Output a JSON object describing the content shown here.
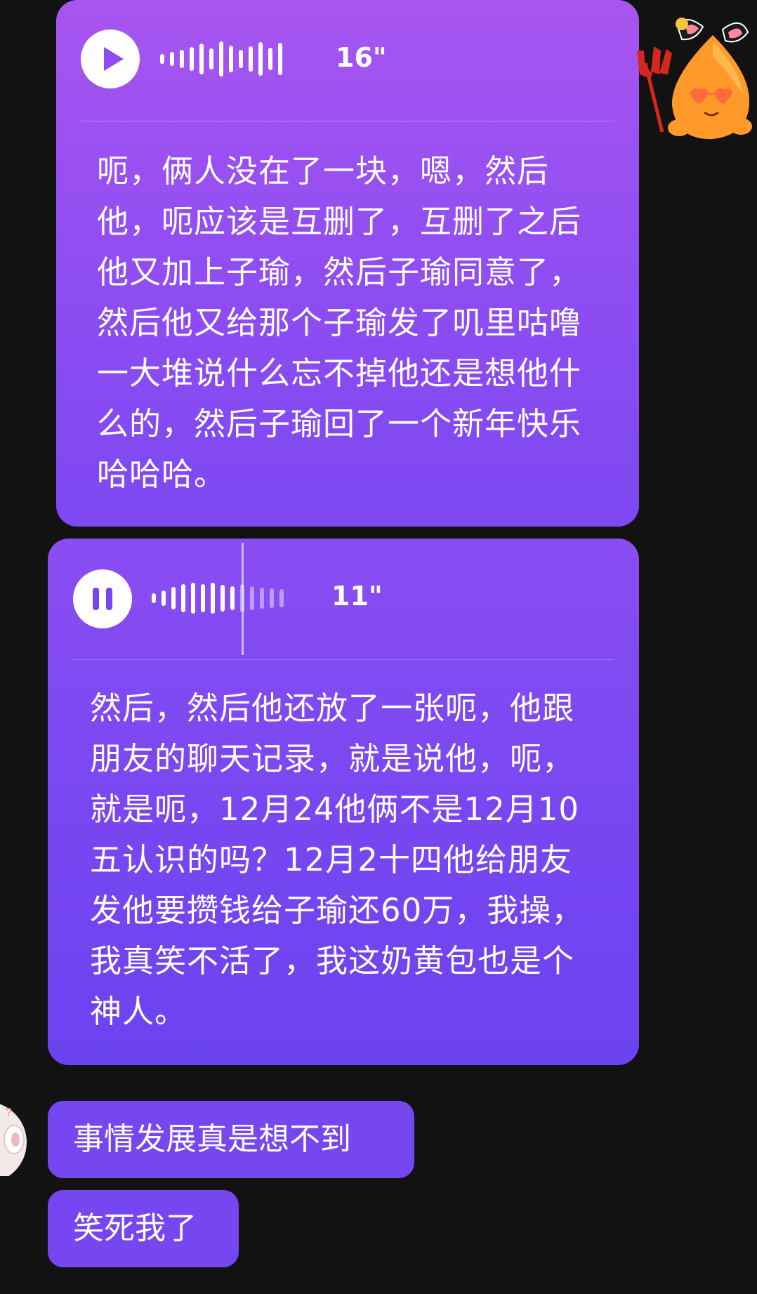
{
  "messages": {
    "voice1": {
      "state": "play",
      "duration": "16\"",
      "transcript": "呃，俩人没在了一块，嗯，然后他，呃应该是互删了，互删了之后他又加上子瑜，然后子瑜同意了，然后他又给那个子瑜发了叽里咕噜一大堆说什么忘不掉他还是想他什么的，然后子瑜回了一个新年快乐哈哈哈。"
    },
    "voice2": {
      "state": "pause",
      "duration": "11\"",
      "transcript": "然后，然后他还放了一张呃，他跟朋友的聊天记录，就是说他，呃，就是呃，12月24他俩不是12月10五认识的吗？12月2十四他给朋友发他要攒钱给子瑜还60万，我操，我真笑不活了，我这奶黄包也是个神人。"
    },
    "text1": "事情发展真是想不到",
    "text2": "笑死我了"
  },
  "avatars": {
    "self": "devil-blob-avatar",
    "other": "bunny-avatar"
  },
  "colors": {
    "background": "#121212",
    "bubble_top": "#a855f0",
    "bubble_bottom": "#6c43f0"
  }
}
